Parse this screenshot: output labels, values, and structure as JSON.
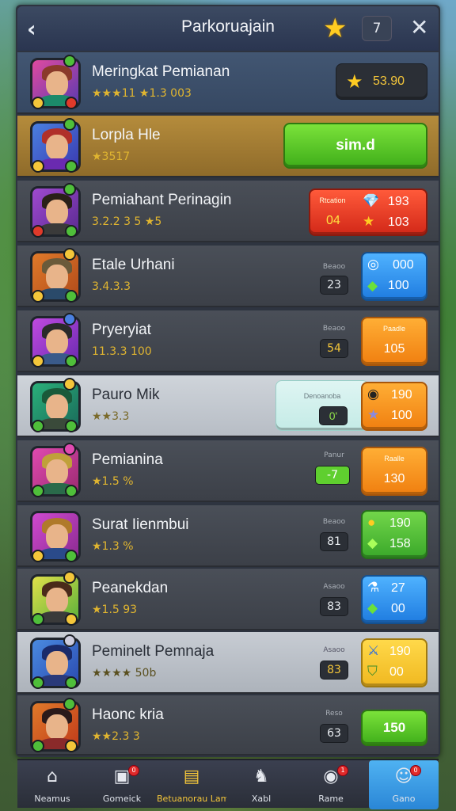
{
  "header": {
    "back_icon": "‹",
    "title": "Parkoruajain",
    "star_icon": "★",
    "badge": "7",
    "close_icon": "✕"
  },
  "rows": [
    {
      "name": "Meringkat Pemianan",
      "sub": "★★★11 ★1.3 003",
      "btn_label": "",
      "btn_text": "53.90",
      "btn_icon": "★"
    },
    {
      "name": "Lorpla Hle",
      "sub": "★3517",
      "btn_text": "sim.d"
    },
    {
      "name": "Pemiahant Perinagin",
      "sub": "3.2.2 3 5 ★5",
      "btn_label": "Rtcation",
      "btn_left": "04",
      "btn_v1": "193",
      "btn_v2": "103"
    },
    {
      "name": "Etale Urhani",
      "sub": "3.4.3.3",
      "mid_label": "Beaoo",
      "mid_val": "23",
      "btn_v1": "000",
      "btn_v2": "100"
    },
    {
      "name": "Pryeryiat",
      "sub": "11.3.3 100",
      "mid_label": "Beaoo",
      "mid_val": "54",
      "btn_label": "Paadle",
      "btn_text": "105"
    },
    {
      "name": "Pauro Mik",
      "sub": "★★3.3",
      "mid_label": "Denoanoba",
      "mid_val": "0'",
      "btn_v1": "190",
      "btn_v2": "100"
    },
    {
      "name": "Pemianina",
      "sub": "★1.5 %",
      "mid_label": "Panur",
      "mid_val": "-7",
      "btn_label": "Raalle",
      "btn_text": "130"
    },
    {
      "name": "Surat Iienmbui",
      "sub": "★1.3 %",
      "mid_label": "Beaoo",
      "mid_val": "81",
      "btn_v1": "190",
      "btn_v2": "158"
    },
    {
      "name": "Peanekdan",
      "sub": "★1.5 93",
      "mid_label": "Asaoo",
      "mid_val": "83",
      "btn_v1": "27",
      "btn_v2": "00"
    },
    {
      "name": "Peminelt Pemnaja",
      "sub": "★★★★ 50b",
      "mid_label": "Asaoo",
      "mid_val": "83",
      "btn_v1": "190",
      "btn_v2": "00"
    },
    {
      "name": "Haonc kria",
      "sub": "★★2.3 3",
      "mid_label": "Reso",
      "mid_val": "63",
      "btn_text": "150"
    }
  ],
  "nav": [
    {
      "label": "Neamus",
      "icon": "⌂"
    },
    {
      "label": "Gomeick",
      "icon": "▣",
      "badge": "0"
    },
    {
      "label": "Betuanorau Lamra",
      "icon": "▤"
    },
    {
      "label": "Xabl",
      "icon": "♞"
    },
    {
      "label": "Rame",
      "icon": "◉",
      "badge": "1"
    },
    {
      "label": "Gano",
      "icon": "☺",
      "badge": "0"
    }
  ],
  "colors": {
    "accent_green": "#3fae1a",
    "gold": "#f4c63a",
    "header": "#2a3550"
  }
}
